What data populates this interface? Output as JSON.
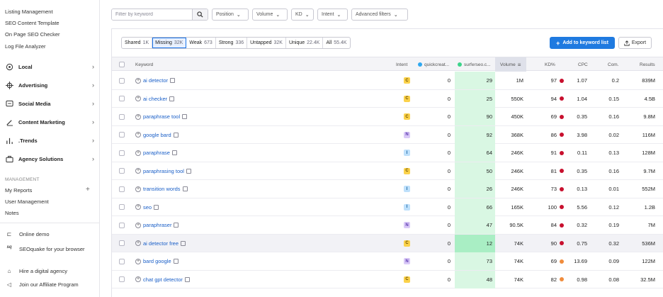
{
  "sidebar": {
    "top_links": [
      "Listing Management",
      "SEO Content Template",
      "On Page SEO Checker",
      "Log File Analyzer"
    ],
    "sections": [
      {
        "label": "Local",
        "icon": "location-pin-icon"
      },
      {
        "label": "Advertising",
        "icon": "target-icon"
      },
      {
        "label": "Social Media",
        "icon": "chat-bubble-icon"
      },
      {
        "label": "Content Marketing",
        "icon": "document-pencil-icon"
      },
      {
        "label": ".Trends",
        "icon": "bar-chart-icon"
      },
      {
        "label": "Agency Solutions",
        "icon": "briefcase-icon"
      }
    ],
    "management_heading": "MANAGEMENT",
    "management_links": [
      "My Reports",
      "User Management",
      "Notes"
    ],
    "bottom_links": [
      {
        "label": "Online demo",
        "icon": "presentation-icon"
      },
      {
        "label": "SEOquake for your browser",
        "icon": "seoquake-icon"
      },
      {
        "label": "Hire a digital agency",
        "icon": "agency-icon"
      },
      {
        "label": "Join our Affiliate Program",
        "icon": "megaphone-icon"
      }
    ]
  },
  "filters": {
    "search_placeholder": "Filter by keyword",
    "dropdowns": [
      "Position",
      "Volume",
      "KD",
      "Intent",
      "Advanced filters"
    ]
  },
  "tabs": [
    {
      "label": "Shared",
      "count": "1K"
    },
    {
      "label": "Missing",
      "count": "32K",
      "active": true
    },
    {
      "label": "Weak",
      "count": "673"
    },
    {
      "label": "Strong",
      "count": "336"
    },
    {
      "label": "Untapped",
      "count": "32K"
    },
    {
      "label": "Unique",
      "count": "22.4K"
    },
    {
      "label": "All",
      "count": "55.4K"
    }
  ],
  "actions": {
    "add_label": "Add to keyword list",
    "export_label": "Export"
  },
  "columns": {
    "keyword": "Keyword",
    "intent": "Intent",
    "competitor1": "quickcreat...",
    "competitor2": "surferseo.c...",
    "volume": "Volume",
    "kd": "KD%",
    "cpc": "CPC",
    "com": "Com.",
    "results": "Results"
  },
  "colors": {
    "competitor1": "#2fa8f0",
    "competitor2": "#3cd48a",
    "accent": "#1f7ae0"
  },
  "rows": [
    {
      "keyword": "ai detector",
      "intent": "C",
      "c1": "0",
      "c2": "29",
      "volume": "1M",
      "kd": "97",
      "kd_color": "#c8102e",
      "cpc": "1.07",
      "com": "0.2",
      "results": "839M"
    },
    {
      "keyword": "ai checker",
      "intent": "C",
      "c1": "0",
      "c2": "25",
      "volume": "550K",
      "kd": "94",
      "kd_color": "#c8102e",
      "cpc": "1.04",
      "com": "0.15",
      "results": "4.5B"
    },
    {
      "keyword": "paraphrase tool",
      "intent": "C",
      "c1": "0",
      "c2": "90",
      "volume": "450K",
      "kd": "69",
      "kd_color": "#c8102e",
      "cpc": "0.35",
      "com": "0.16",
      "results": "9.8M"
    },
    {
      "keyword": "google bard",
      "intent": "N",
      "c1": "0",
      "c2": "92",
      "volume": "368K",
      "kd": "86",
      "kd_color": "#c8102e",
      "cpc": "3.98",
      "com": "0.02",
      "results": "116M"
    },
    {
      "keyword": "paraphrase",
      "intent": "I",
      "c1": "0",
      "c2": "64",
      "volume": "246K",
      "kd": "91",
      "kd_color": "#c8102e",
      "cpc": "0.11",
      "com": "0.13",
      "results": "128M"
    },
    {
      "keyword": "paraphrasing tool",
      "intent": "C",
      "c1": "0",
      "c2": "50",
      "volume": "246K",
      "kd": "81",
      "kd_color": "#c8102e",
      "cpc": "0.35",
      "com": "0.16",
      "results": "9.7M"
    },
    {
      "keyword": "transition words",
      "intent": "I",
      "c1": "0",
      "c2": "26",
      "volume": "246K",
      "kd": "73",
      "kd_color": "#c8102e",
      "cpc": "0.13",
      "com": "0.01",
      "results": "552M"
    },
    {
      "keyword": "seo",
      "intent": "I",
      "c1": "0",
      "c2": "66",
      "volume": "165K",
      "kd": "100",
      "kd_color": "#c8102e",
      "cpc": "5.56",
      "com": "0.12",
      "results": "1.2B"
    },
    {
      "keyword": "paraphraser",
      "intent": "N",
      "c1": "0",
      "c2": "47",
      "volume": "90.5K",
      "kd": "84",
      "kd_color": "#c8102e",
      "cpc": "0.32",
      "com": "0.19",
      "results": "7M"
    },
    {
      "keyword": "ai detector free",
      "intent": "C",
      "c1": "0",
      "c2": "12",
      "volume": "74K",
      "kd": "90",
      "kd_color": "#c8102e",
      "cpc": "0.75",
      "com": "0.32",
      "results": "536M",
      "highlight": true
    },
    {
      "keyword": "bard google",
      "intent": "N",
      "c1": "0",
      "c2": "73",
      "volume": "74K",
      "kd": "69",
      "kd_color": "#f08c3c",
      "cpc": "13.69",
      "com": "0.09",
      "results": "122M"
    },
    {
      "keyword": "chat gpt detector",
      "intent": "C",
      "c1": "0",
      "c2": "48",
      "volume": "74K",
      "kd": "82",
      "kd_color": "#f08c3c",
      "cpc": "0.98",
      "com": "0.08",
      "results": "32.5M"
    }
  ]
}
